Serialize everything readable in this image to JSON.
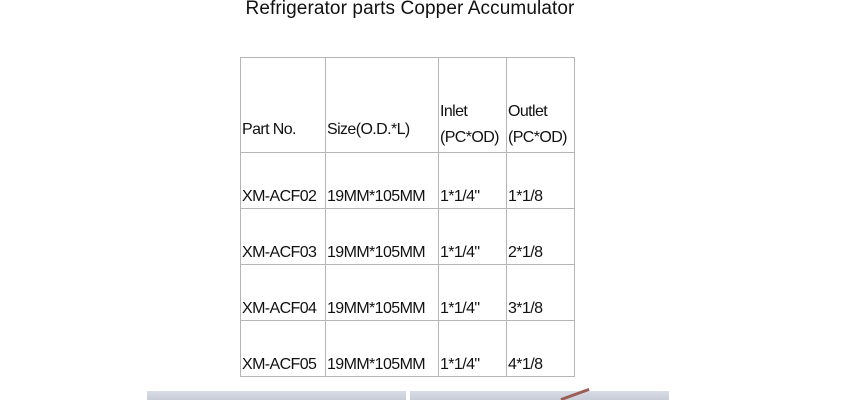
{
  "title": "Refrigerator parts Copper Accumulator",
  "table": {
    "headers": {
      "part_no": "Part No.",
      "size": "Size(O.D.*L)",
      "inlet_line1": "Inlet",
      "inlet_line2": "(PC*OD)",
      "outlet_line1": "Outlet",
      "outlet_line2": "(PC*OD)"
    },
    "rows": [
      {
        "part_no": "XM-ACF02",
        "size": "19MM*105MM",
        "inlet": "1*1/4\"",
        "outlet": "1*1/8"
      },
      {
        "part_no": "XM-ACF03",
        "size": "19MM*105MM",
        "inlet": "1*1/4\"",
        "outlet": "2*1/8"
      },
      {
        "part_no": "XM-ACF04",
        "size": "19MM*105MM",
        "inlet": "1*1/4\"",
        "outlet": "3*1/8"
      },
      {
        "part_no": "XM-ACF05",
        "size": "19MM*105MM",
        "inlet": "1*1/4\"",
        "outlet": "4*1/8"
      }
    ]
  },
  "colors": {
    "border": "#b5b5b5",
    "text": "#111111",
    "photo": "#d9dde6"
  }
}
